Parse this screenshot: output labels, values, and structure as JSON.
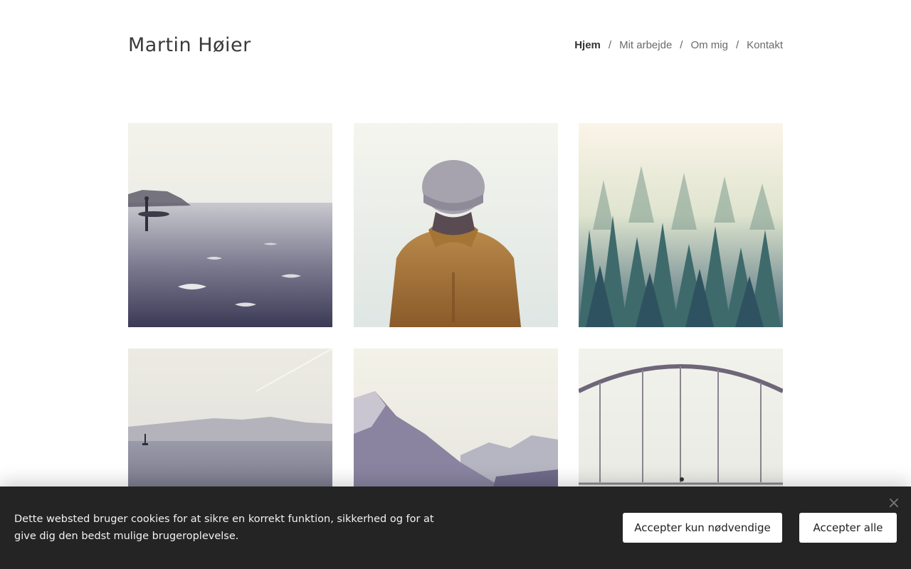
{
  "site": {
    "title": "Martin Høier"
  },
  "nav": {
    "items": [
      {
        "label": "Hjem",
        "active": true
      },
      {
        "label": "Mit arbejde",
        "active": false
      },
      {
        "label": "Om mig",
        "active": false
      },
      {
        "label": "Kontakt",
        "active": false
      }
    ],
    "separator": "/"
  },
  "gallery": {
    "images": [
      {
        "name": "surfer-beach-photo",
        "alt": "Surfer on misty beach"
      },
      {
        "name": "beanie-hood-photo",
        "alt": "Person in beanie and hooded jacket"
      },
      {
        "name": "foggy-forest-photo",
        "alt": "Foggy pine forest"
      },
      {
        "name": "lake-sailboat-photo",
        "alt": "Lake with sailboat and mountains"
      },
      {
        "name": "mountain-valley-photo",
        "alt": "Mountain valley in haze"
      },
      {
        "name": "bridge-cyclist-photo",
        "alt": "Arched bridge with cyclist"
      }
    ]
  },
  "cookie": {
    "text": "Dette websted bruger cookies for at sikre en korrekt funktion, sikkerhed og for at give dig den bedst mulige brugeroplevelse.",
    "accept_necessary_label": "Accepter kun nødvendige",
    "accept_all_label": "Accepter alle",
    "close_icon": "close-icon"
  },
  "colors": {
    "cookie_bg": "#242424",
    "button_bg": "#ffffff",
    "text_dark": "#333333"
  }
}
